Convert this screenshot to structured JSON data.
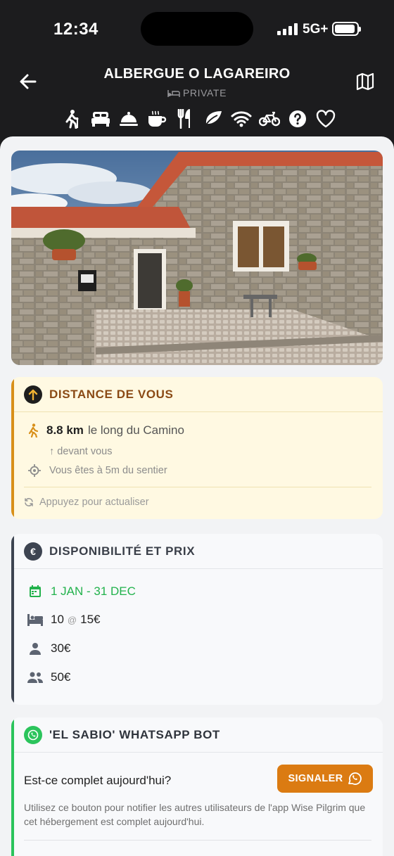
{
  "status_bar": {
    "time": "12:34",
    "network": "5G+"
  },
  "header": {
    "title": "ALBERGUE O LAGAREIRO",
    "type": "PRIVATE",
    "amenity_icons": [
      "hiker-icon",
      "bed-icon",
      "cloche-icon",
      "coffee-cup-icon",
      "cutlery-icon",
      "leaf-icon",
      "wifi-icon",
      "bicycle-icon",
      "question-icon",
      "heart-icon"
    ]
  },
  "photo": {
    "subject": "stone albergue building with terracotta roof and courtyard"
  },
  "distance_card": {
    "title": "DISTANCE DE VOUS",
    "distance": "8.8 km",
    "distance_suffix": "le long du Camino",
    "direction": "↑ devant vous",
    "trail_offset": "Vous êtes à 5m du sentier",
    "refresh": "Appuyez pour actualiser",
    "colors": {
      "accent": "#d8901a",
      "background": "#fff9e2",
      "title": "#8a4a15"
    }
  },
  "availability_card": {
    "title": "DISPONIBILITÉ ET PRIX",
    "icon_glyph": "€",
    "dates": "1 JAN - 31 DEC",
    "beds_count": "10",
    "beds_at": "@",
    "beds_price": "15€",
    "single_price": "30€",
    "double_price": "50€",
    "colors": {
      "accent": "#3d4451",
      "dates": "#22b24c"
    }
  },
  "whatsapp_card": {
    "title": "'EL SABIO' WHATSAPP BOT",
    "question": "Est-ce complet aujourd'hui?",
    "button_label": "SIGNALER",
    "description": "Utilisez ce bouton pour notifier les autres utilisateurs de l'app Wise Pilgrim que cet hébergement est complet aujourd'hui.",
    "colors": {
      "accent": "#2bc45c",
      "button": "#db7b12"
    }
  }
}
